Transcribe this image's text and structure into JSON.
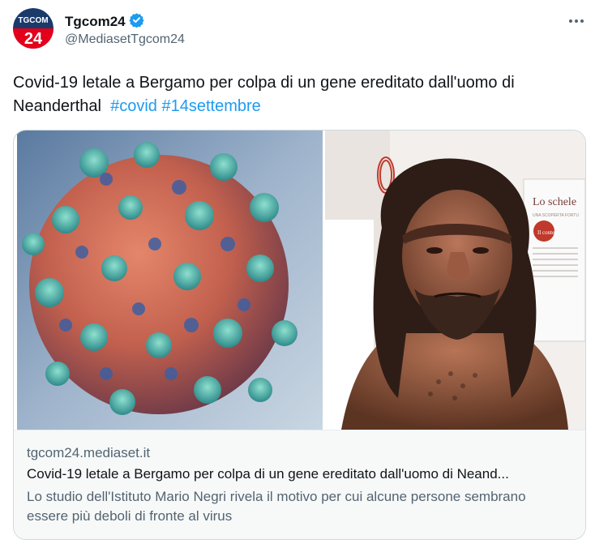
{
  "author": {
    "name": "Tgcom24",
    "handle": "@MediasetTgcom24",
    "verified": true,
    "avatar_text_top": "TGCOM",
    "avatar_text_bottom": "24"
  },
  "tweet": {
    "text": "Covid-19 letale a Bergamo per colpa di un gene ereditato dall'uomo di Neanderthal",
    "hashtags": [
      "#covid",
      "#14settembre"
    ]
  },
  "card": {
    "domain": "tgcom24.mediaset.it",
    "title": "Covid-19 letale a Bergamo per colpa di un gene ereditato dall'uomo di Neand...",
    "description": "Lo studio dell'Istituto Mario Negri rivela il motivo per cui alcune persone sembrano essere più deboli di fronte al virus",
    "right_image_sign_title": "Lo schele",
    "right_image_sign_subtitle": "UNA SCOPERTA FORTU",
    "right_image_sign_section": "Il contesto"
  },
  "icons": {
    "verified": "verified-badge-icon",
    "more": "more-icon"
  },
  "colors": {
    "accent": "#1d9bf0",
    "secondary_text": "#536471",
    "brand_red": "#e2001a"
  }
}
